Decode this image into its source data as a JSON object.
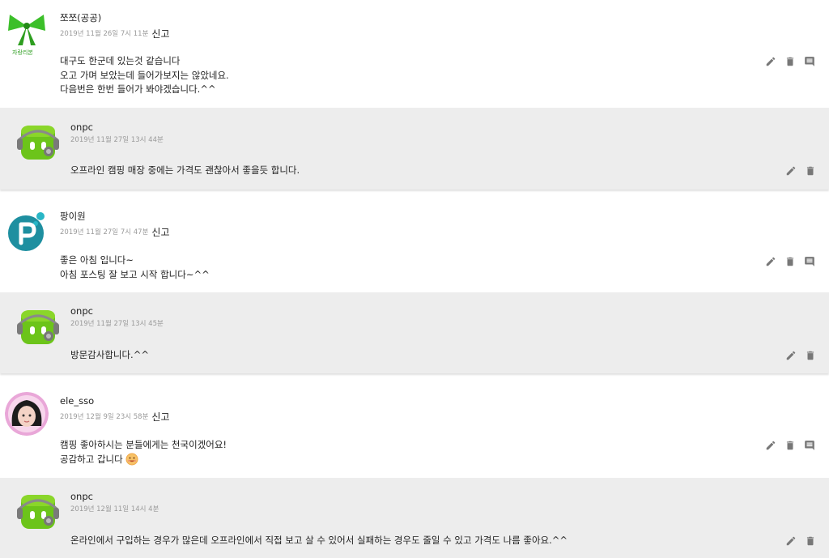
{
  "report_label": "신고",
  "comments": [
    {
      "author": "쪼쪼(공공)",
      "date": "2019년 11월 26일 7시 11분",
      "lines": [
        "대구도 한군데 있는것 같습니다",
        "오고 가며 보았는데 들어가보지는 않았네요.",
        "다음번은 한번 들어가 봐야겠습니다.^^"
      ],
      "avatar_caption": "자랑리본",
      "reply": {
        "author": "onpc",
        "date": "2019년 11월 27일 13시 44분",
        "lines": [
          "오프라인 캠핑 매장 중에는 가격도 괜찮아서 좋을듯 합니다."
        ]
      }
    },
    {
      "author": "팡이원",
      "date": "2019년 11월 27일 7시 47분",
      "lines": [
        "좋은 아침 입니다~",
        "아침 포스팅 잘 보고 시작 합니다~^^"
      ],
      "reply": {
        "author": "onpc",
        "date": "2019년 11월 27일 13시 45분",
        "lines": [
          "방문감사합니다.^^"
        ]
      }
    },
    {
      "author": "ele_sso",
      "date": "2019년 12월 9일 23시 58분",
      "lines": [
        "캠핑 좋아하시는 분들에게는 천국이겠어요!",
        "공감하고 갑니다"
      ],
      "reply": {
        "author": "onpc",
        "date": "2019년 12월 11일 14시 4분",
        "lines": [
          "온라인에서 구입하는 경우가 많은데 오프라인에서 직접 보고 살 수 있어서 실패하는 경우도 줄일 수 있고 가격도 나름 좋아요.^^"
        ]
      }
    }
  ]
}
